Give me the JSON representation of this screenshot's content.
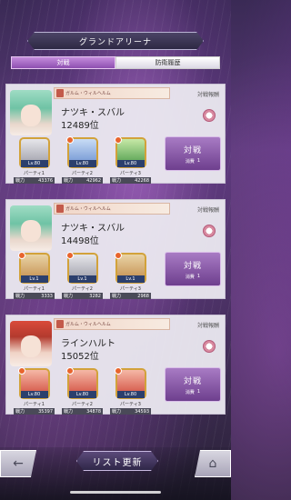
{
  "header": {
    "title": "グランドアリーナ"
  },
  "tabs": [
    {
      "label": "対戦",
      "active": true
    },
    {
      "label": "防衛履歴",
      "active": false
    }
  ],
  "cards": [
    {
      "banner": "ガルム・ウィルヘルム",
      "record_label": "対戦報酬",
      "player_name": "ナツキ・スバル",
      "rank": "12489位",
      "battle_label": "対戦",
      "cost_label": "消費",
      "cost_value": "1",
      "teams": [
        {
          "label": "パーティ1",
          "power_label": "戦力",
          "power": "43376",
          "lv": "Lv.80"
        },
        {
          "label": "パーティ2",
          "power_label": "戦力",
          "power": "42962",
          "lv": "Lv.80"
        },
        {
          "label": "パーティ3",
          "power_label": "戦力",
          "power": "42268",
          "lv": "Lv.80"
        }
      ]
    },
    {
      "banner": "ガルム・ウィルヘルム",
      "record_label": "対戦報酬",
      "player_name": "ナツキ・スバル",
      "rank": "14498位",
      "battle_label": "対戦",
      "cost_label": "消費",
      "cost_value": "1",
      "teams": [
        {
          "label": "パーティ1",
          "power_label": "戦力",
          "power": "3333",
          "lv": "Lv.1"
        },
        {
          "label": "パーティ2",
          "power_label": "戦力",
          "power": "3282",
          "lv": "Lv.1"
        },
        {
          "label": "パーティ3",
          "power_label": "戦力",
          "power": "2968",
          "lv": "Lv.1"
        }
      ]
    },
    {
      "banner": "ガルム・ウィルヘルム",
      "record_label": "対戦報酬",
      "player_name": "ラインハルト",
      "rank": "15052位",
      "battle_label": "対戦",
      "cost_label": "消費",
      "cost_value": "1",
      "teams": [
        {
          "label": "パーティ1",
          "power_label": "戦力",
          "power": "35397",
          "lv": "Lv.80"
        },
        {
          "label": "パーティ2",
          "power_label": "戦力",
          "power": "34878",
          "lv": "Lv.80"
        },
        {
          "label": "パーティ3",
          "power_label": "戦力",
          "power": "34593",
          "lv": "Lv.80"
        }
      ]
    }
  ],
  "footer": {
    "refresh_label": "リスト更新",
    "back_icon": "←",
    "home_icon": "⌂"
  }
}
